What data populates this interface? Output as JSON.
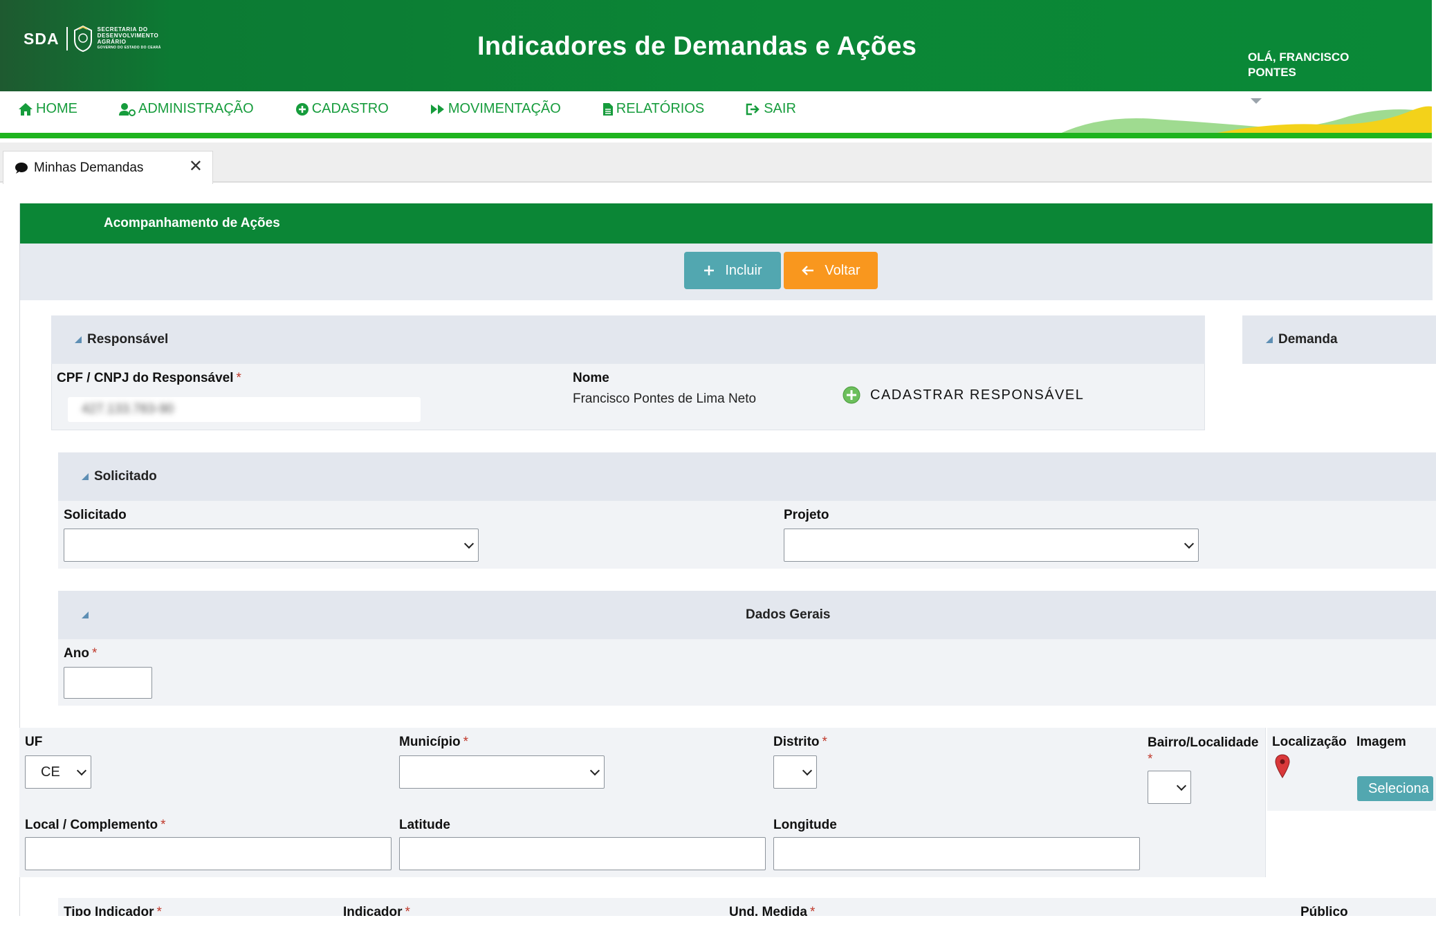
{
  "header": {
    "logo": {
      "abbr": "SDA",
      "line1": "SECRETARIA DO",
      "line2": "DESENVOLVIMENTO",
      "line3": "AGRÁRIO",
      "line4": "GOVERNO DO ESTADO DO CEARÁ"
    },
    "title": "Indicadores de Demandas e Ações",
    "greeting": "OLÁ, FRANCISCO PONTES"
  },
  "nav": {
    "home": "HOME",
    "admin": "ADMINISTRAÇÃO",
    "cadastro": "CADASTRO",
    "movimentacao": "MOVIMENTAÇÃO",
    "relatorios": "RELATÓRIOS",
    "sair": "SAIR"
  },
  "tabs": [
    {
      "label": "Minhas Demandas",
      "close": "✕"
    }
  ],
  "panel": {
    "title": "Acompanhamento de Ações",
    "buttons": {
      "incluir": "Incluir",
      "voltar": "Voltar"
    }
  },
  "responsavel": {
    "legend": "Responsável",
    "cpf_label": "CPF / CNPJ do Responsável",
    "cpf_value": "427.133.783-90",
    "nome_label": "Nome",
    "nome_value": "Francisco Pontes de Lima Neto",
    "cadastrar": "CADASTRAR RESPONSÁVEL"
  },
  "demanda": {
    "legend": "Demanda"
  },
  "solicitado": {
    "legend": "Solicitado",
    "solicitado_label": "Solicitado",
    "projeto_label": "Projeto"
  },
  "dados_gerais": {
    "legend": "Dados Gerais",
    "ano_label": "Ano"
  },
  "localizacao": {
    "uf_label": "UF",
    "uf_value": "CE",
    "municipio_label": "Município",
    "distrito_label": "Distrito",
    "bairro_label": "Bairro/Localidade",
    "localizacao_label": "Localização",
    "imagem_label": "Imagem",
    "selecionar": "Seleciona",
    "local_label": "Local / Complemento",
    "latitude_label": "Latitude",
    "longitude_label": "Longitude"
  },
  "indicadores": {
    "tipo_label": "Tipo Indicador",
    "indicador_label": "Indicador",
    "und_label": "Und. Medida",
    "publico_label": "Público"
  },
  "required_mark": "*",
  "colors": {
    "header_green": "#0b8636",
    "nav_green": "#169c3c",
    "teal_button": "#52a7b0",
    "orange_button": "#f9971e",
    "required_red": "#c0392b"
  }
}
